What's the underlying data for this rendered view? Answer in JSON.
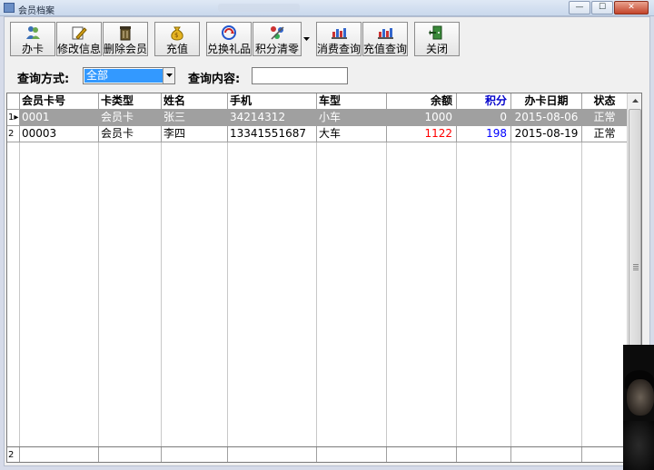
{
  "window": {
    "title": "会员档案"
  },
  "toolbar": {
    "buttons": [
      {
        "label": "办卡",
        "icon": "people-icon"
      },
      {
        "label": "修改信息",
        "icon": "edit-icon"
      },
      {
        "label": "删除会员",
        "icon": "trash-icon"
      },
      {
        "label": "充值",
        "icon": "money-bag-icon"
      },
      {
        "label": "兑换礼品",
        "icon": "exchange-icon"
      },
      {
        "label": "积分清零",
        "icon": "reset-points-icon"
      },
      {
        "label": "消费查询",
        "icon": "query-chart-icon"
      },
      {
        "label": "充值查询",
        "icon": "query-chart-icon"
      },
      {
        "label": "关闭",
        "icon": "exit-icon"
      }
    ]
  },
  "query": {
    "method_label": "查询方式:",
    "method_value": "全部",
    "content_label": "查询内容:",
    "content_value": ""
  },
  "table": {
    "headers": [
      "会员卡号",
      "卡类型",
      "姓名",
      "手机",
      "车型",
      "余额",
      "积分",
      "办卡日期",
      "状态"
    ],
    "rows": [
      {
        "indicator": "1",
        "card_no": "0001",
        "card_type": "会员卡",
        "name": "张三",
        "phone": "34214312",
        "car": "小车",
        "balance": "1000",
        "points": "0",
        "date": "2015-08-06",
        "status": "正常"
      },
      {
        "indicator": "2",
        "card_no": "00003",
        "card_type": "会员卡",
        "name": "李四",
        "phone": "13341551687",
        "car": "大车",
        "balance": "1122",
        "points": "198",
        "date": "2015-08-19",
        "status": "正常"
      }
    ],
    "footer_count": "2"
  },
  "colors": {
    "balance": "#ff0000",
    "points": "#0000ff",
    "header_balance": "#ff0000",
    "header_points": "#0000cc"
  }
}
